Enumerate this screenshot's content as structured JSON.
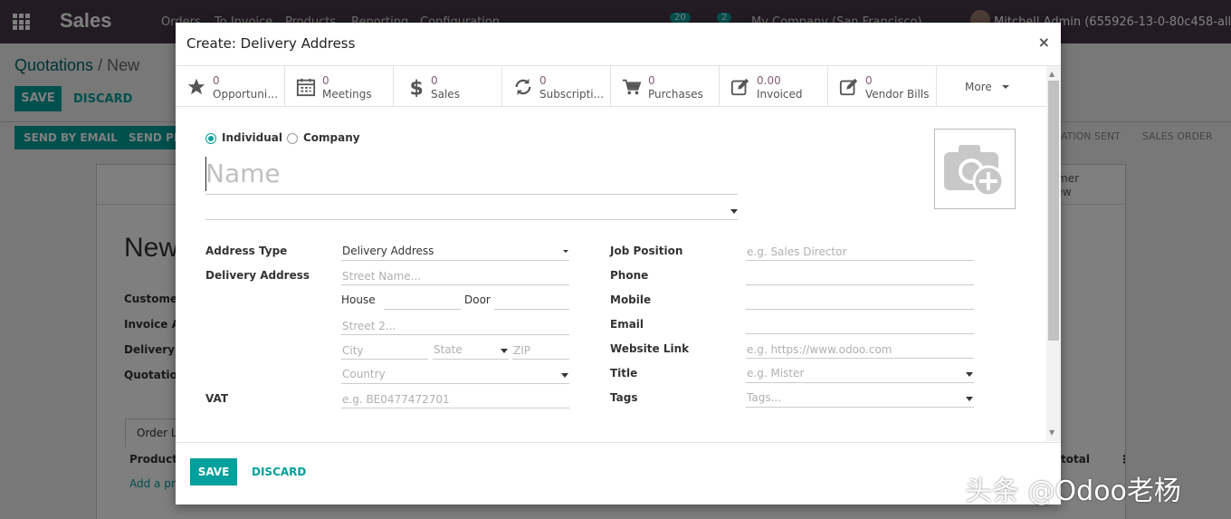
{
  "app": {
    "brand": "Sales",
    "menu": [
      "Orders",
      "To Invoice",
      "Products",
      "Reporting",
      "Configuration"
    ],
    "activity_count": "20",
    "message_count": "2",
    "company": "My Company (San Francisco)",
    "user": "Mitchell Admin (655926-13-0-80c458-all)"
  },
  "background": {
    "breadcrumb_root": "Quotations",
    "breadcrumb_sep": "/",
    "breadcrumb_current": "New",
    "save_label": "SAVE",
    "discard_label": "DISCARD",
    "send_email_label": "SEND BY EMAIL",
    "send_pro_label": "SEND PR",
    "status_sent": "ATION SENT",
    "status_order": "SALES ORDER",
    "customer_preview": "tomer\nview",
    "title": "New",
    "labels": [
      "Customer",
      "Invoice A",
      "Delivery A",
      "Quotation"
    ],
    "tab_order_lines": "Order Li",
    "col_product": "Product",
    "col_total": "total",
    "add_product": "Add a pro"
  },
  "modal": {
    "title": "Create: Delivery Address",
    "close": "×",
    "stats": [
      {
        "icon": "star-icon",
        "value": "0",
        "label": "Opportunit..."
      },
      {
        "icon": "calendar-icon",
        "value": "0",
        "label": "Meetings"
      },
      {
        "icon": "dollar-icon",
        "value": "0",
        "label": "Sales"
      },
      {
        "icon": "refresh-icon",
        "value": "0",
        "label": "Subscripti..."
      },
      {
        "icon": "cart-icon",
        "value": "0",
        "label": "Purchases"
      },
      {
        "icon": "edit-icon",
        "value": "0.00",
        "label": "Invoiced"
      },
      {
        "icon": "edit-icon",
        "value": "0",
        "label": "Vendor Bills"
      }
    ],
    "more_label": "More",
    "type_individual": "Individual",
    "type_company": "Company",
    "name_placeholder": "Name",
    "left_fields": {
      "address_type_label": "Address Type",
      "address_type_value": "Delivery Address",
      "delivery_address_label": "Delivery Address",
      "street_placeholder": "Street Name...",
      "house_label": "House",
      "door_label": "Door",
      "street2_placeholder": "Street 2...",
      "city_placeholder": "City",
      "state_placeholder": "State",
      "zip_placeholder": "ZIP",
      "country_placeholder": "Country",
      "vat_label": "VAT",
      "vat_placeholder": "e.g. BE0477472701"
    },
    "right_fields": {
      "job_position_label": "Job Position",
      "job_position_placeholder": "e.g. Sales Director",
      "phone_label": "Phone",
      "mobile_label": "Mobile",
      "email_label": "Email",
      "website_label": "Website Link",
      "website_placeholder": "e.g. https://www.odoo.com",
      "title_label": "Title",
      "title_placeholder": "e.g. Mister",
      "tags_label": "Tags",
      "tags_placeholder": "Tags..."
    },
    "save_label": "SAVE",
    "discard_label": "DISCARD"
  },
  "watermark": "头条 @Odoo老杨",
  "colors": {
    "primary": "#00a09d",
    "navbar": "#463749",
    "stat_value": "#875a7b"
  }
}
